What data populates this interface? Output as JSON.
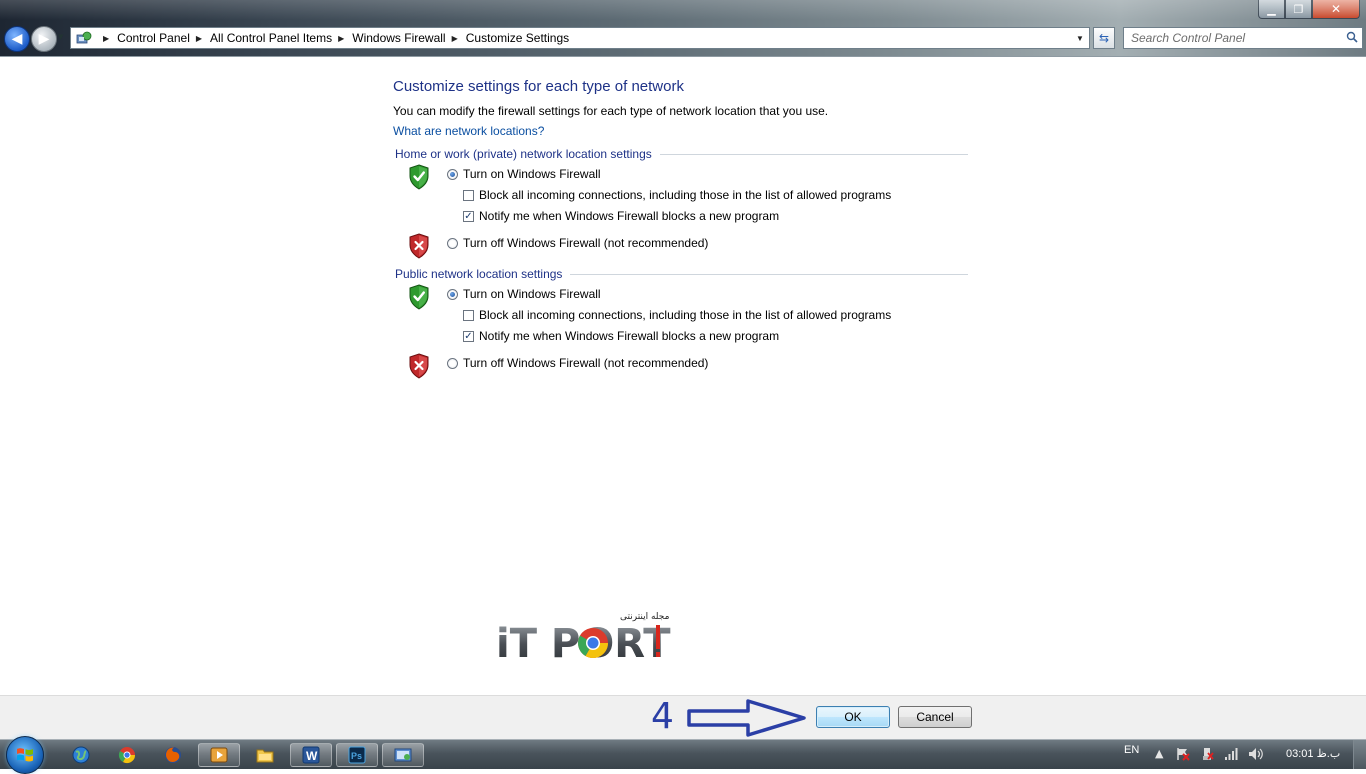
{
  "window": {
    "controls": {
      "minimize": "▁",
      "maximize": "❐",
      "close": "✕"
    }
  },
  "nav": {
    "back_icon": "arrow-left-icon",
    "forward_icon": "arrow-right-icon"
  },
  "address_bar": {
    "breadcrumbs": [
      "Control Panel",
      "All Control Panel Items",
      "Windows Firewall",
      "Customize Settings"
    ]
  },
  "search": {
    "placeholder": "Search Control Panel"
  },
  "content": {
    "title": "Customize settings for each type of network",
    "description": "You can modify the firewall settings for each type of network location that you use.",
    "link": "What are network locations?",
    "groups": [
      {
        "heading": "Home or work (private) network location settings",
        "turn_on_label": "Turn on Windows Firewall",
        "turn_on_selected": true,
        "block_all_label": "Block all incoming connections, including those in the list of allowed programs",
        "block_all_checked": false,
        "notify_label": "Notify me when Windows Firewall blocks a new program",
        "notify_checked": true,
        "turn_off_label": "Turn off Windows Firewall (not recommended)",
        "turn_off_selected": false
      },
      {
        "heading": "Public network location settings",
        "turn_on_label": "Turn on Windows Firewall",
        "turn_on_selected": true,
        "block_all_label": "Block all incoming connections, including those in the list of allowed programs",
        "block_all_checked": false,
        "notify_label": "Notify me when Windows Firewall blocks a new program",
        "notify_checked": true,
        "turn_off_label": "Turn off Windows Firewall (not recommended)",
        "turn_off_selected": false
      }
    ]
  },
  "watermark": {
    "logo_text": "iT PORT",
    "subtitle": "مجله اینترنتی"
  },
  "annotation": {
    "step_number": "4"
  },
  "buttons": {
    "ok": "OK",
    "cancel": "Cancel"
  },
  "taskbar": {
    "language": "EN",
    "clock": "03:01 ب.ظ",
    "pinned": [
      "globe-icon",
      "chrome-icon",
      "firefox-icon",
      "media-player-icon",
      "folder-icon",
      "word-icon",
      "photoshop-icon",
      "control-panel-icon"
    ]
  },
  "colors": {
    "heading_blue": "#1e3287",
    "link_blue": "#0b4fa1",
    "annotation_blue": "#2b3fa6",
    "shield_green": "#2f9a2f",
    "shield_red": "#c0282a"
  }
}
